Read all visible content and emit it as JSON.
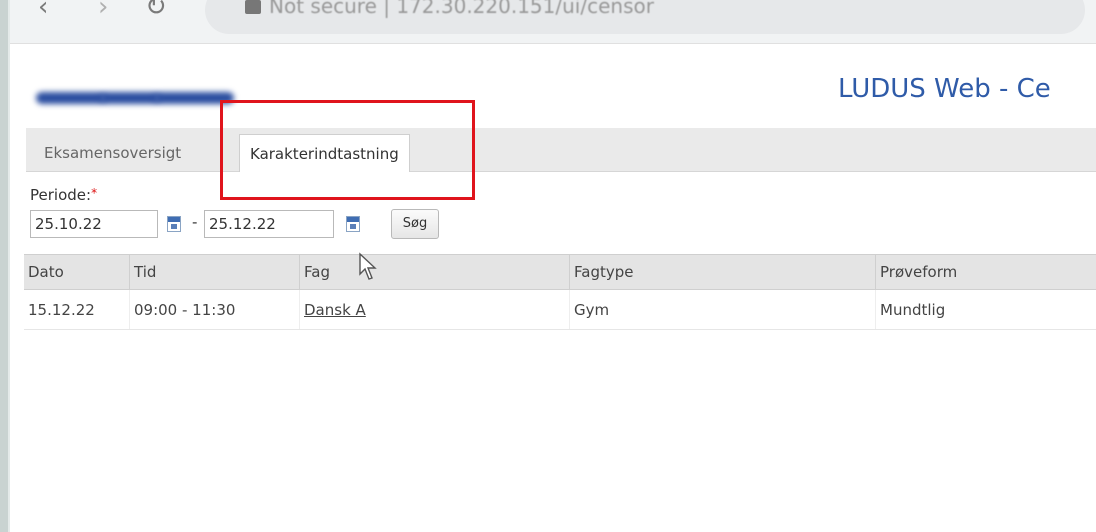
{
  "browser": {
    "url_text": "Not secure | 172.30.220.151/ui/censor"
  },
  "header": {
    "app_title": "LUDUS Web - Ce"
  },
  "tabs": [
    {
      "label": "Eksamensoversigt",
      "active": false
    },
    {
      "label": "Karakterindtastning",
      "active": true
    }
  ],
  "filter": {
    "period_label": "Periode:",
    "required_marker": "*",
    "date_from": "25.10.22",
    "separator": "-",
    "date_to": "25.12.22",
    "search_label": "Søg"
  },
  "table": {
    "columns": [
      "Dato",
      "Tid",
      "Fag",
      "Fagtype",
      "Prøveform"
    ],
    "rows": [
      {
        "dato": "15.12.22",
        "tid": "09:00 - 11:30",
        "fag": "Dansk A",
        "fagtype": "Gym",
        "proeveform": "Mundtlig"
      }
    ]
  },
  "colors": {
    "highlight": "#e0141c",
    "title_blue": "#2f5ba8"
  }
}
